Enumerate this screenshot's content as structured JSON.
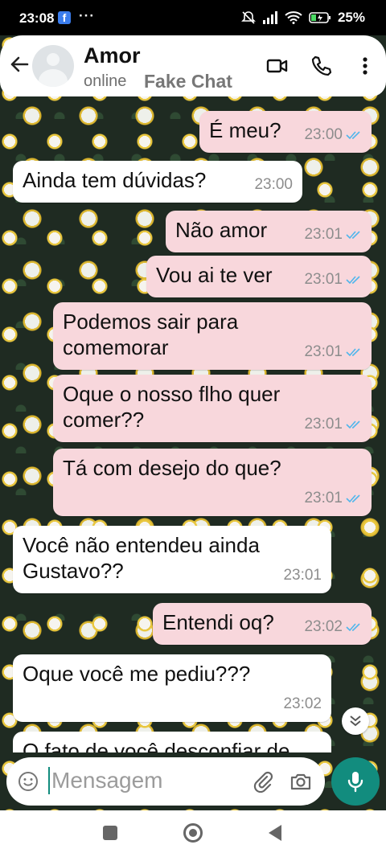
{
  "status_bar": {
    "time": "23:08",
    "dots": "···",
    "battery": "25%"
  },
  "header": {
    "contact_name": "Amor",
    "status": "online",
    "watermark": "Fake Chat"
  },
  "messages": [
    {
      "dir": "out",
      "text": "É meu?",
      "time": "23:00",
      "read": true
    },
    {
      "dir": "in",
      "text": "Ainda tem dúvidas?",
      "time": "23:00"
    },
    {
      "dir": "out",
      "text": "Não amor",
      "time": "23:01",
      "read": true
    },
    {
      "dir": "out",
      "text": "Vou ai te ver",
      "time": "23:01",
      "read": true
    },
    {
      "dir": "out",
      "text": "Podemos sair para comemorar",
      "time": "23:01",
      "read": true
    },
    {
      "dir": "out",
      "text": "Oque o nosso flho quer comer??",
      "time": "23:01",
      "read": true
    },
    {
      "dir": "out",
      "text": "Tá com desejo do que?",
      "time": "23:01",
      "read": true
    },
    {
      "dir": "in",
      "text": "Você não entendeu ainda Gustavo??",
      "time": "23:01"
    },
    {
      "dir": "out",
      "text": "Entendi oq?",
      "time": "23:02",
      "read": true
    },
    {
      "dir": "in",
      "text": "Oque você me pediu???",
      "time": "23:02"
    },
    {
      "dir": "in",
      "text": "O fato de você desconfiar de",
      "time": ""
    }
  ],
  "input": {
    "placeholder": "Mensagem"
  },
  "colors": {
    "outgoing_bubble": "#f8d7dc",
    "incoming_bubble": "#ffffff",
    "accent": "#128c7e",
    "read_ticks": "#4fb6ec"
  }
}
